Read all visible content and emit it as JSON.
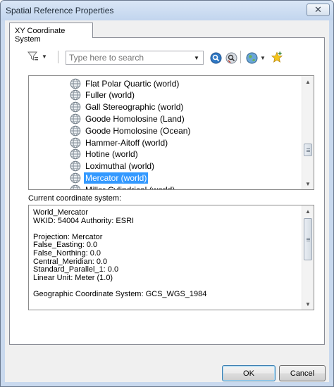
{
  "window": {
    "title": "Spatial Reference Properties",
    "close_glyph": "✕"
  },
  "tabs": [
    {
      "label": "XY Coordinate System",
      "selected": true
    }
  ],
  "toolbar": {
    "filter_icon": "filter-icon",
    "search_placeholder": "Type here to search",
    "search_icon": "magnifier-icon",
    "clear_search_icon": "clear-search-icon",
    "globe_menu_icon": "globe-icon",
    "add_favorite_icon": "star-add-icon"
  },
  "coordinate_list": {
    "items": [
      {
        "label": "Flat Polar Quartic (world)",
        "selected": false
      },
      {
        "label": "Fuller (world)",
        "selected": false
      },
      {
        "label": "Gall Stereographic (world)",
        "selected": false
      },
      {
        "label": "Goode Homolosine (Land)",
        "selected": false
      },
      {
        "label": "Goode Homolosine (Ocean)",
        "selected": false
      },
      {
        "label": "Hammer-Aitoff (world)",
        "selected": false
      },
      {
        "label": "Hotine (world)",
        "selected": false
      },
      {
        "label": "Loximuthal (world)",
        "selected": false
      },
      {
        "label": "Mercator (world)",
        "selected": true
      },
      {
        "label": "Miller Cylindrical (world)",
        "selected": false
      }
    ],
    "scroll_position_fraction": 0.72
  },
  "current_system": {
    "label": "Current coordinate system:",
    "lines": [
      "World_Mercator",
      "WKID: 54004 Authority: ESRI",
      "",
      "Projection: Mercator",
      "False_Easting: 0.0",
      "False_Northing: 0.0",
      "Central_Meridian: 0.0",
      "Standard_Parallel_1: 0.0",
      "Linear Unit: Meter (1.0)",
      "",
      "Geographic Coordinate System: GCS_WGS_1984"
    ]
  },
  "buttons": {
    "ok": "OK",
    "cancel": "Cancel"
  },
  "colors": {
    "selection": "#3399ff",
    "titlebar": "#c9d9ee"
  }
}
